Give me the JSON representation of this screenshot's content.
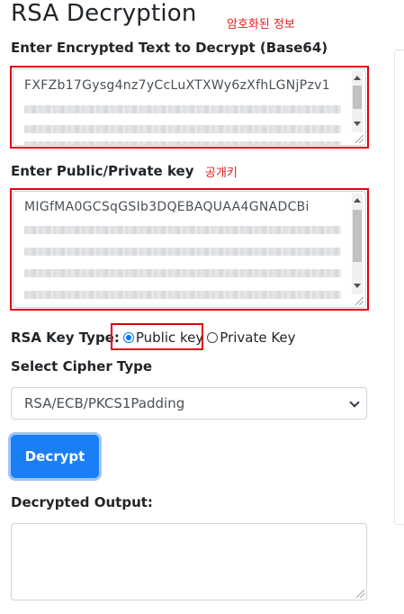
{
  "page": {
    "title": "RSA Decryption",
    "annotation_encrypted": "암호화된 정보",
    "annotation_key": "공개키"
  },
  "encrypted": {
    "label": "Enter Encrypted Text to Decrypt (Base64)",
    "value_first_line": "FXFZb17Gysg4nz7yCcLuXTXWy6zXfhLGNjPzv1"
  },
  "key": {
    "label": "Enter Public/Private key",
    "value_first_line": "MIGfMA0GCSqGSIb3DQEBAQUAA4GNADCBi"
  },
  "key_type": {
    "label": "RSA Key Type:",
    "options": [
      {
        "label": "Public key",
        "checked": true
      },
      {
        "label": "Private Key",
        "checked": false
      }
    ]
  },
  "cipher": {
    "label": "Select Cipher Type",
    "selected": "RSA/ECB/PKCS1Padding"
  },
  "actions": {
    "decrypt_label": "Decrypt"
  },
  "output": {
    "label": "Decrypted Output:",
    "value": ""
  },
  "colors": {
    "highlight": "#e3000f",
    "button": "#1a7ff5",
    "radio_accent": "#0075ff"
  }
}
